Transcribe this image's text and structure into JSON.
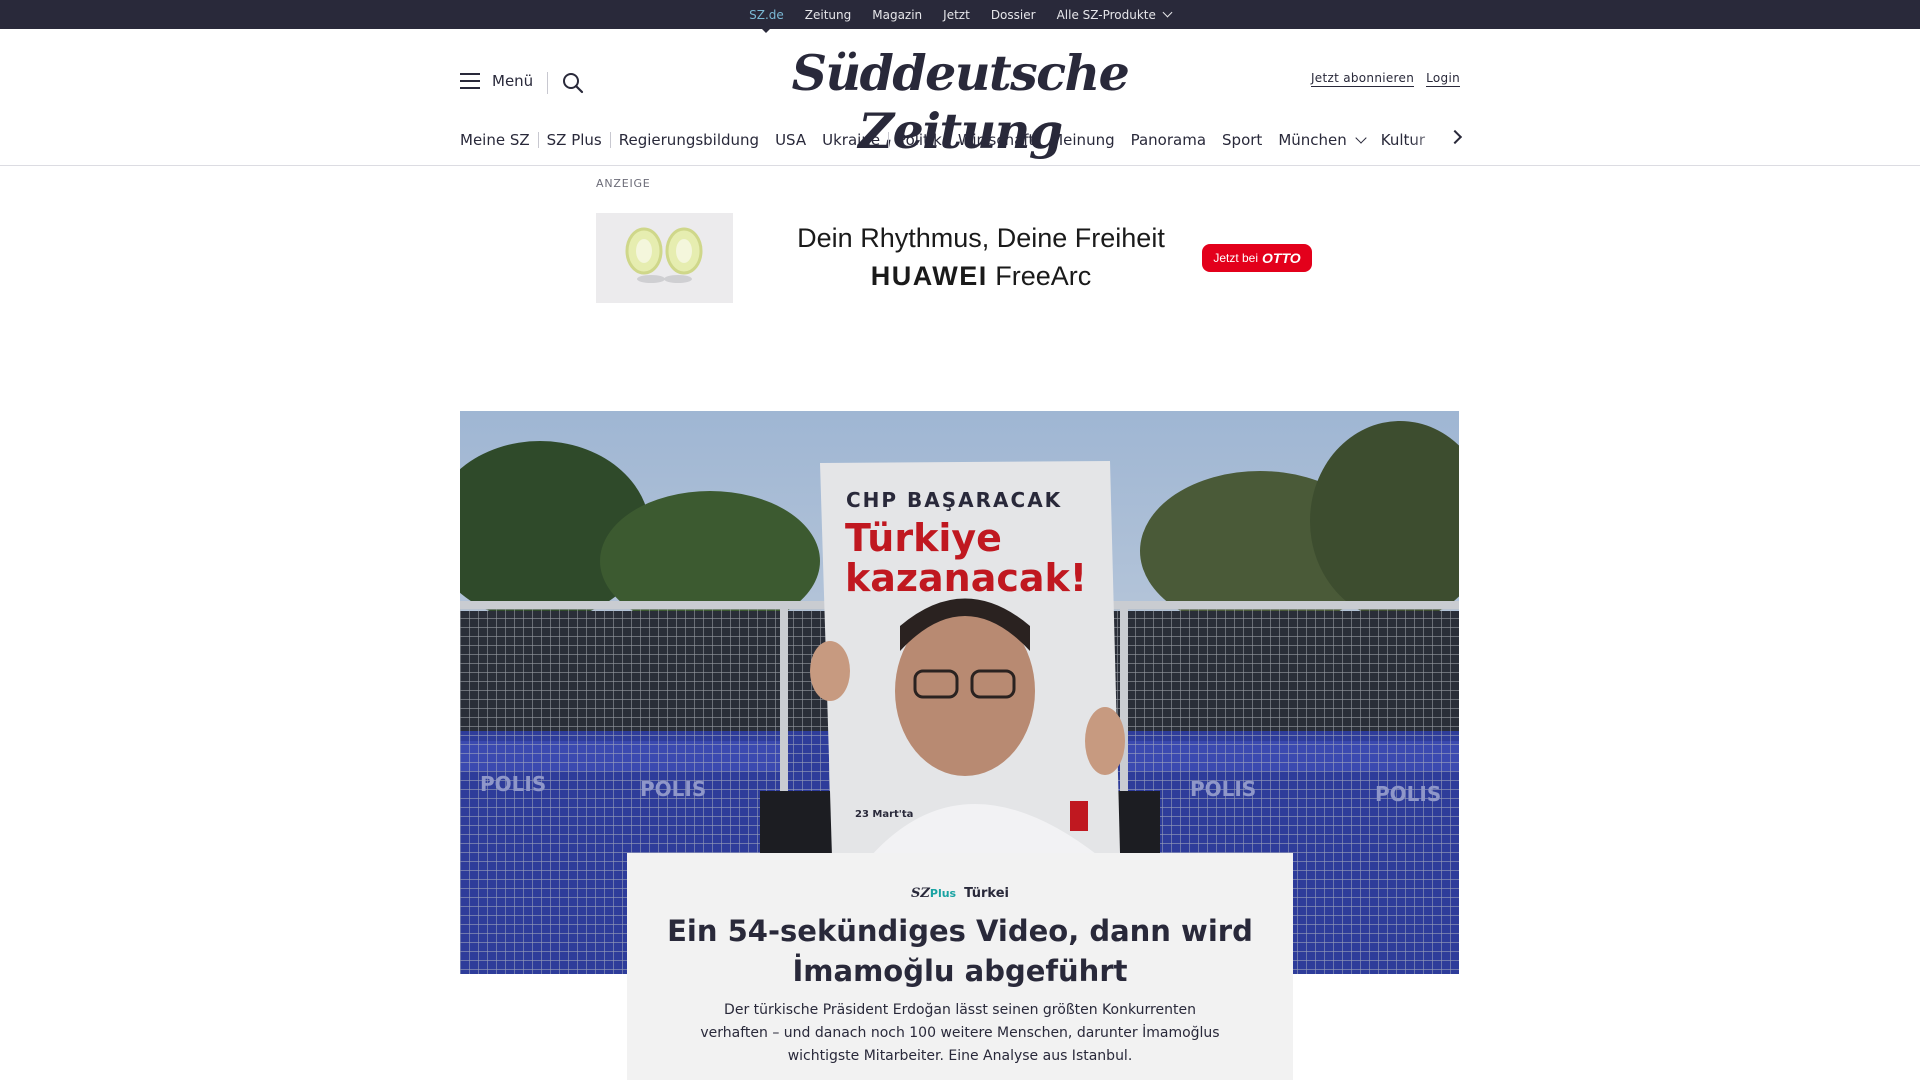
{
  "topbar": {
    "items": [
      {
        "label": "SZ.de",
        "active": true
      },
      {
        "label": "Zeitung"
      },
      {
        "label": "Magazin"
      },
      {
        "label": "Jetzt"
      },
      {
        "label": "Dossier"
      },
      {
        "label": "Alle SZ-Produkte",
        "has_dropdown": true
      }
    ]
  },
  "header": {
    "menu_label": "Menü",
    "logo": "Süddeutsche Zeitung",
    "subscribe": "Jetzt abonnieren",
    "login": "Login"
  },
  "nav": {
    "items": [
      "Meine SZ",
      "SZ Plus",
      "Regierungsbildung",
      "USA",
      "Ukraine",
      "Politik",
      "Wirtschaft",
      "Meinung",
      "Panorama",
      "Sport",
      "München",
      "Kultur"
    ]
  },
  "ad": {
    "label": "ANZEIGE",
    "line1": "Dein Rhythmus, Deine Freiheit",
    "brand": "HUAWEI",
    "product": "FreeArc",
    "cta_prefix": "Jetzt bei",
    "cta_brand": "OTTO"
  },
  "hero": {
    "sign_top": "CHP BAŞARACAK",
    "sign_line1": "Türkiye",
    "sign_line2": "kazanacak!",
    "sign_date": "23 Mart'ta",
    "polis1": "POLIS",
    "polis2": "POLIS",
    "polis3": "POLIS",
    "polis4": "POLIS"
  },
  "article": {
    "badge_sz": "SZ",
    "badge_plus": "Plus",
    "kicker": "Türkei",
    "title": "Ein 54-sekündiges Video, dann wird İmamoğlu abgeführt",
    "teaser": "Der türkische Präsident Erdoğan lässt seinen größten Konkurrenten verhaften – und danach noch 100 weitere Menschen, darunter İmamoğlus wichtigste Mitarbeiter. Eine Analyse aus Istanbul."
  },
  "colors": {
    "topbar_bg": "#29293a",
    "active_link": "#7ab8d4",
    "sz_plus_accent": "#1aa3a3",
    "ad_cta": "#e3001b",
    "card_bg": "#f2f2f2"
  }
}
